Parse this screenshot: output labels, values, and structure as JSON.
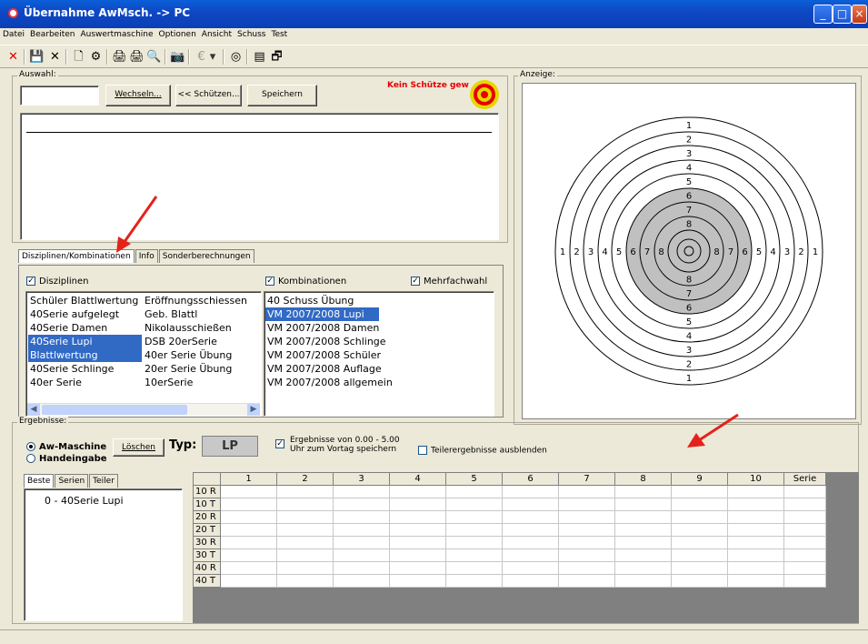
{
  "window": {
    "title": "Übernahme AwMsch. -> PC",
    "buttons": [
      "_",
      "□",
      "×"
    ]
  },
  "menu": [
    "Datei",
    "Bearbeiten",
    "Auswertmaschine",
    "Optionen",
    "Ansicht",
    "Schuss",
    "Test"
  ],
  "toolbar": {
    "icons": [
      "close-red-x-icon",
      "save-icon",
      "delete-x-icon",
      "new-document-icon",
      "settings-gear-icon",
      "print-icon",
      "print-setup-icon",
      "print-preview-icon",
      "camera-icon",
      "euro-icon",
      "dropdown-arrow-icon",
      "target-icon",
      "list-icon",
      "properties-icon"
    ],
    "glyphs": [
      "✕",
      "💾",
      "✕",
      "🗋",
      "⚙",
      "🖨",
      "🖨",
      "🔍",
      "📷",
      "€",
      "▾",
      "◎",
      "▤",
      "🗗"
    ]
  },
  "auswahl": {
    "label": "Auswahl:",
    "input_value": "",
    "wechseln": "Wechseln...",
    "schuetzen": "<< Schützen...",
    "speichern": "Speichern",
    "status": "Kein Schütze gew"
  },
  "tabs": {
    "items": [
      "Disziplinen/Kombinationen",
      "Info",
      "Sonderberechnungen"
    ],
    "active": 0
  },
  "disziplinen": {
    "label": "Disziplinen",
    "checked": true,
    "col1": [
      "Schüler Blattlwertung",
      "40Serie aufgelegt",
      "40Serie Damen",
      "40Serie Lupi",
      "Blattlwertung",
      "40Serie Schlinge",
      "40er Serie"
    ],
    "col2": [
      "Eröffnungsschiessen",
      "Geb. Blattl",
      "Nikolausschießen",
      "DSB 20erSerie",
      "40er Serie Übung",
      "20er Serie Übung",
      "10erSerie"
    ],
    "selected_rows": [
      3,
      4
    ]
  },
  "kombinationen": {
    "label": "Kombinationen",
    "checked": true,
    "mehrfach_label": "Mehrfachwahl",
    "mehrfach_checked": true,
    "items": [
      "40 Schuss Übung",
      "VM 2007/2008 Lupi",
      "VM 2007/2008 Damen",
      "VM 2007/2008 Schlinge",
      "VM 2007/2008 Schüler",
      "VM 2007/2008 Auflage",
      "VM 2007/2008 allgemein"
    ],
    "selected": 1
  },
  "anzeige": {
    "label": "Anzeige:",
    "ring_labels": [
      "1",
      "2",
      "3",
      "4",
      "5",
      "6",
      "7",
      "8"
    ]
  },
  "ergebnisse": {
    "label": "Ergebnisse:",
    "radio_aw": "Aw-Maschine",
    "radio_hand": "Handeingabe",
    "loeschen": "Löschen",
    "typ_label": "Typ:",
    "typ_value": "LP",
    "chk_range_line1": "Ergebnisse von 0.00 - 5.00",
    "chk_range_line2": "Uhr zum Vortag speichern",
    "chk_teiler": "Teilerergebnisse ausblenden",
    "subtabs": [
      "Beste",
      "Serien",
      "Teiler"
    ],
    "best_list": [
      "0 - 40Serie Lupi"
    ],
    "columns": [
      "1",
      "2",
      "3",
      "4",
      "5",
      "6",
      "7",
      "8",
      "9",
      "10",
      "Serie"
    ],
    "rows": [
      "10 R",
      "10 T",
      "20 R",
      "20 T",
      "30 R",
      "30 T",
      "40 R",
      "40 T"
    ]
  },
  "colors": {
    "titlebar": "#0a4fc8",
    "selection": "#316ac5",
    "target_gray": "#c0c0c0",
    "arrow": "#e3231b",
    "status_red": "#e60000"
  }
}
